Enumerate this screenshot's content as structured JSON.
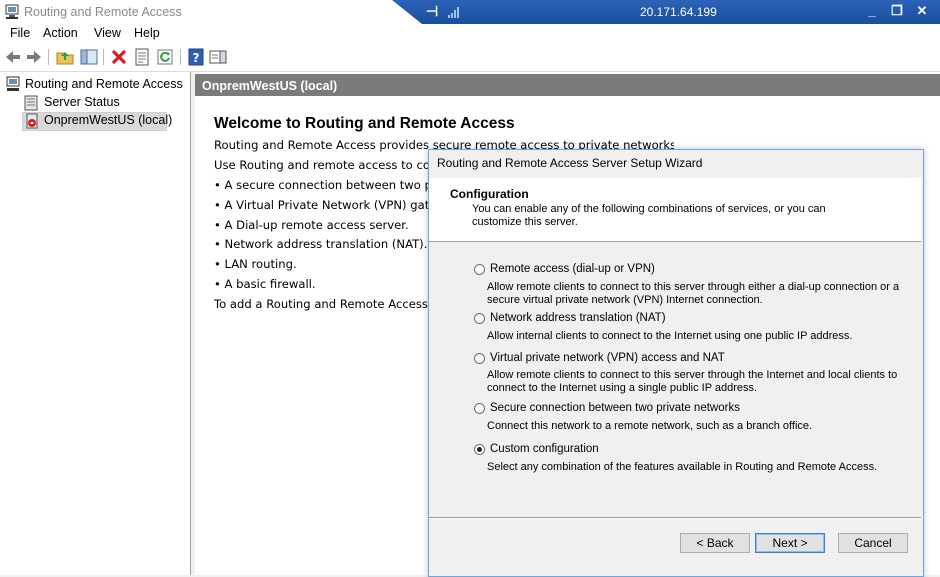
{
  "window": {
    "title": "Routing and Remote Access"
  },
  "rdp": {
    "pin": "⊣",
    "ip": "20.171.64.199",
    "min": "_",
    "restore": "❐",
    "close": "✕"
  },
  "menu": [
    "File",
    "Action",
    "View",
    "Help"
  ],
  "tree": {
    "root": "Routing and Remote Access",
    "items": [
      "Server Status",
      "OnpremWestUS (local)"
    ]
  },
  "content": {
    "header": "OnpremWestUS (local)",
    "title": "Welcome to Routing and Remote Access",
    "lines": [
      "Routing and Remote Access provides secure remote access to private networks",
      "Use Routing and remote access to configure the following:",
      "• A secure connection between two private networks.",
      "• A Virtual Private Network (VPN) gateway.",
      "• A Dial-up remote access server.",
      "• Network address translation (NAT).",
      "• LAN routing.",
      "• A basic firewall.",
      "To add a Routing and Remote Access"
    ]
  },
  "dialog": {
    "title": "Routing and Remote Access Server Setup Wizard",
    "section": "Configuration",
    "description": "You can enable any of the following combinations of services, or you can customize this server.",
    "options": [
      {
        "label": "Remote access (dial-up or VPN)",
        "desc": "Allow remote clients to connect to this server through either a dial-up connection or a secure virtual private network (VPN) Internet connection.",
        "selected": false
      },
      {
        "label": "Network address translation (NAT)",
        "desc": "Allow internal clients to connect to the Internet using one public IP address.",
        "selected": false
      },
      {
        "label": "Virtual private network (VPN) access and NAT",
        "desc": "Allow remote clients to connect to this server through the Internet and local clients to connect to the Internet using a single public IP address.",
        "selected": false
      },
      {
        "label": "Secure connection between two private networks",
        "desc": "Connect this network to a remote network, such as a branch office.",
        "selected": false
      },
      {
        "label": "Custom configuration",
        "desc": "Select any combination of the features available in Routing and Remote Access.",
        "selected": true
      }
    ],
    "buttons": {
      "back": "< Back",
      "next": "Next >",
      "cancel": "Cancel"
    }
  }
}
